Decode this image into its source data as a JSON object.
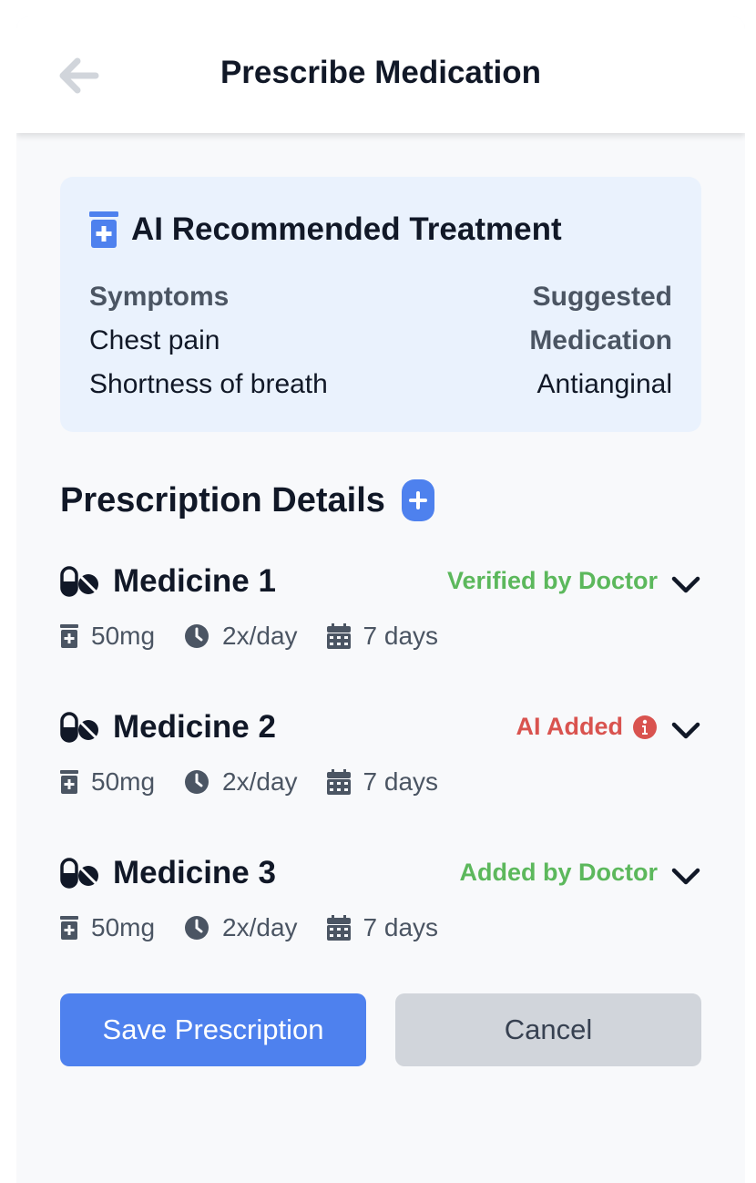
{
  "header": {
    "title": "Prescribe Medication",
    "back_icon": "arrow-left-icon"
  },
  "ai_card": {
    "title": "AI Recommended Treatment",
    "icon": "prescription-bottle-icon",
    "symptoms_label": "Symptoms",
    "symptoms": [
      "Chest pain",
      "Shortness of breath"
    ],
    "suggested_label_line1": "Suggested",
    "suggested_label_line2": "Medication",
    "suggested_value": "Antianginal"
  },
  "prescription": {
    "title": "Prescription Details",
    "add_icon": "plus-icon",
    "medicines": [
      {
        "name": "Medicine 1",
        "status": "Verified by Doctor",
        "status_color": "#5cb85c",
        "dose": "50mg",
        "frequency": "2x/day",
        "duration": "7 days"
      },
      {
        "name": "Medicine 2",
        "status": "AI Added",
        "status_color": "#d9534f",
        "dose": "50mg",
        "frequency": "2x/day",
        "duration": "7 days"
      },
      {
        "name": "Medicine 3",
        "status": "Added by Doctor",
        "status_color": "#5cb85c",
        "dose": "50mg",
        "frequency": "2x/day",
        "duration": "7 days"
      }
    ]
  },
  "actions": {
    "save_label": "Save Prescription",
    "cancel_label": "Cancel"
  },
  "colors": {
    "primary": "#4e81ee",
    "card_bg": "#eaf2fd",
    "verified": "#5cb85c",
    "ai_added": "#d9534f"
  }
}
